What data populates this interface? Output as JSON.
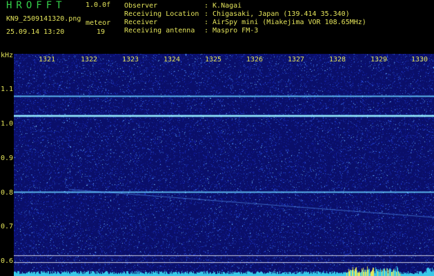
{
  "header": {
    "brand": "HROFFT",
    "version": "1.0.0f",
    "filename": "KN9_2509141320.png",
    "datetime": "25.09.14 13:20",
    "meteor_label": "meteor",
    "meteor_count": "19",
    "info": [
      {
        "label": "Observer",
        "value": ": K.Nagai"
      },
      {
        "label": "Receiving Location",
        "value": ": Chigasaki, Japan (139.414 35.340)"
      },
      {
        "label": "Receiver",
        "value": ": AirSpy mini (Miakejima VOR 108.65MHz)"
      },
      {
        "label": "Receiving antenna",
        "value": ": Maspro FM-3"
      }
    ]
  },
  "axis": {
    "y_unit": "kHz",
    "y_ticks": [
      "1.1",
      "1.0",
      "0.9",
      "0.8",
      "0.7",
      "0.6"
    ],
    "x_ticks": [
      "1321",
      "1322",
      "1323",
      "1324",
      "1325",
      "1326",
      "1327",
      "1328",
      "1329",
      "1330"
    ]
  },
  "colors": {
    "text": "#e3e35a",
    "brand": "#35d04a",
    "background_noise": "#0a0f6a",
    "carrier": "#7fe0ff"
  },
  "spectrogram": {
    "y_range_khz": [
      0.58,
      1.16
    ],
    "x_range_minutes": [
      1320.9,
      1331.1
    ],
    "carriers_khz": [
      1.05,
      1.0,
      0.8
    ],
    "faint_trail_khz": [
      0.795,
      0.733
    ]
  }
}
